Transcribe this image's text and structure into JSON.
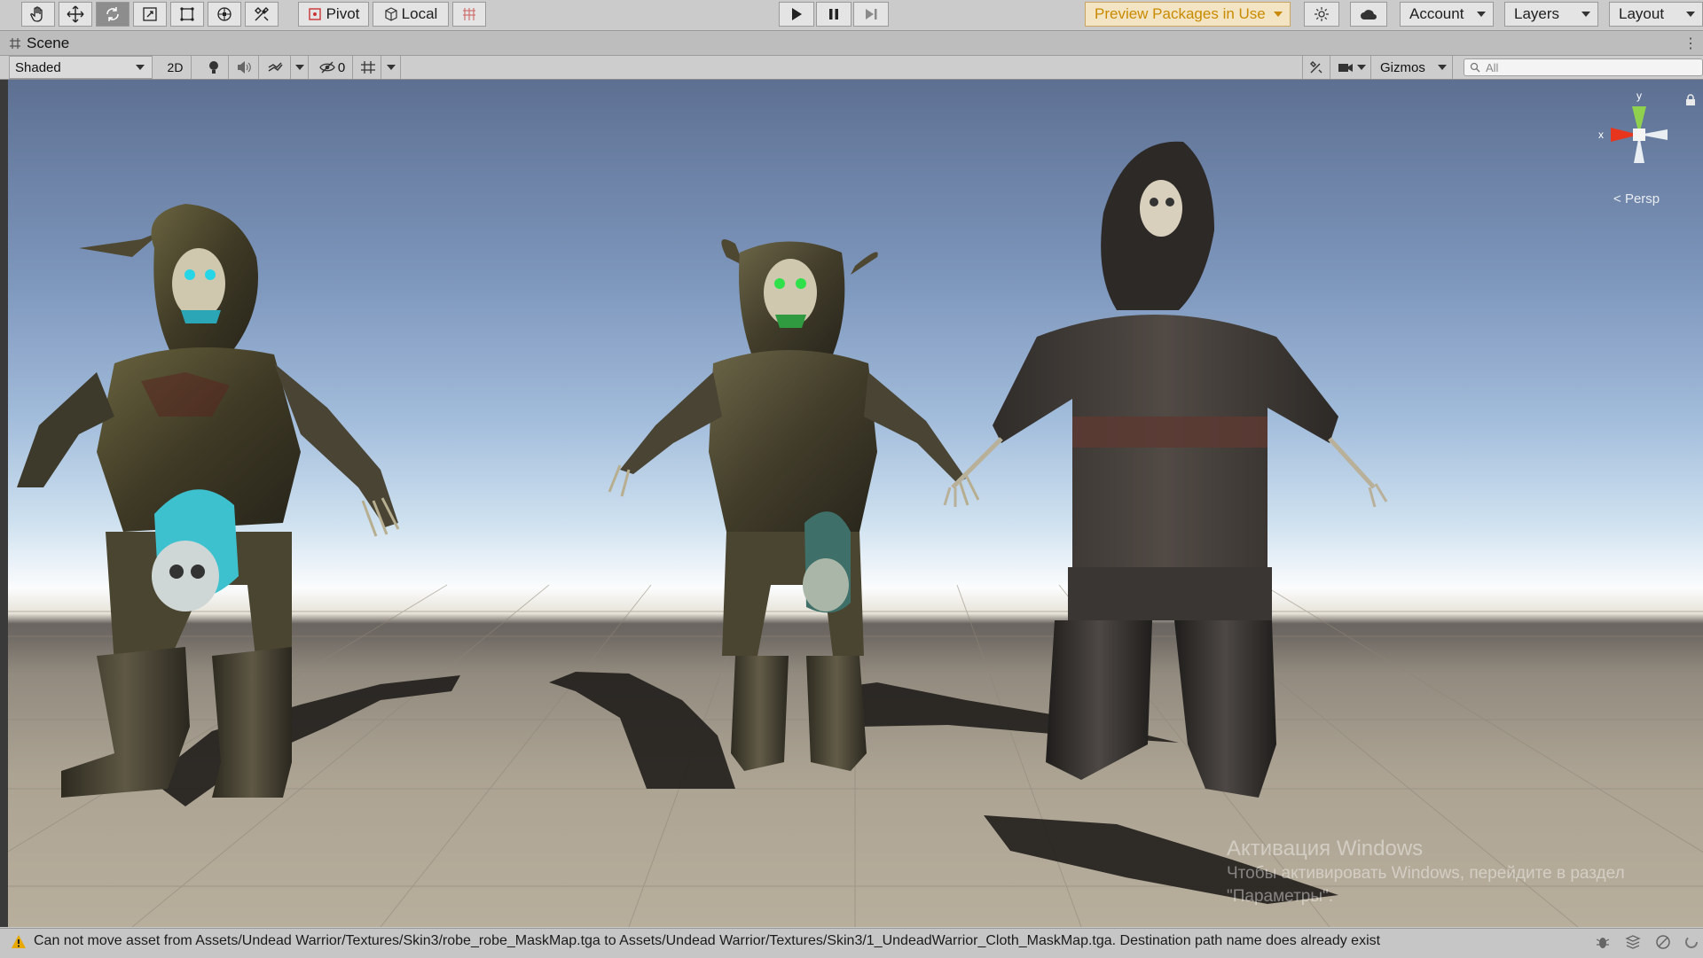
{
  "toolbar": {
    "tools": [
      "hand-tool",
      "move-tool",
      "rotate-tool",
      "scale-tool",
      "rect-tool",
      "transform-tool",
      "custom-tool"
    ],
    "pivot_label": "Pivot",
    "local_label": "Local",
    "play_controls": [
      "play",
      "pause",
      "step"
    ],
    "preview_packages_label": "Preview Packages in Use",
    "account_label": "Account",
    "layers_label": "Layers",
    "layout_label": "Layout"
  },
  "tab": {
    "scene_label": "Scene"
  },
  "scene_toolbar": {
    "shading_mode": "Shaded",
    "mode_2d_label": "2D",
    "hidden_count": "0",
    "gizmos_label": "Gizmos",
    "search_placeholder": "All"
  },
  "viewport": {
    "gizmo_axes": {
      "x": "x",
      "y": "y"
    },
    "projection_label": "Persp",
    "watermark": {
      "title": "Активация Windows",
      "line1": "Чтобы активировать Windows, перейдите в раздел",
      "line2": "\"Параметры\"."
    },
    "figures": [
      "undead-warrior-armored-cyan",
      "undead-warrior-armored-green",
      "undead-warrior-robed"
    ]
  },
  "status": {
    "message": "Can not move asset from Assets/Undead Warrior/Textures/Skin3/robe_robe_MaskMap.tga to Assets/Undead Warrior/Textures/Skin3/1_UndeadWarrior_Cloth_MaskMap.tga. Destination path name does already exist"
  },
  "colors": {
    "accent_warning": "#c98a00",
    "sky_top": "#5d7092",
    "ground": "#aca393"
  }
}
